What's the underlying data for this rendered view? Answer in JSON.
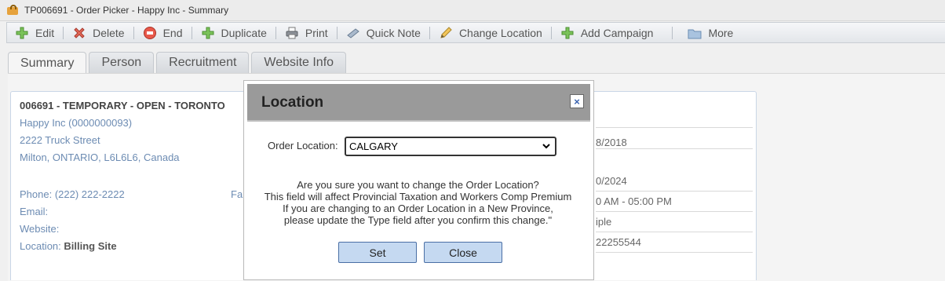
{
  "window": {
    "title": "TP006691 - Order Picker - Happy Inc - Summary",
    "icon": "briefcase-icon"
  },
  "toolbar": {
    "items": [
      {
        "label": "Edit",
        "icon": "plus-icon"
      },
      {
        "label": "Delete",
        "icon": "delete-icon"
      },
      {
        "label": "End",
        "icon": "end-icon"
      },
      {
        "label": "Duplicate",
        "icon": "plus-icon"
      },
      {
        "label": "Print",
        "icon": "printer-icon"
      },
      {
        "label": "Quick Note",
        "icon": "note-icon"
      },
      {
        "label": "Change Location",
        "icon": "pencil-icon"
      },
      {
        "label": "Add Campaign",
        "icon": "plus-icon"
      },
      {
        "label": "More",
        "icon": "folder-icon"
      }
    ]
  },
  "tabs": [
    "Summary",
    "Person",
    "Recruitment",
    "Website Info"
  ],
  "summary": {
    "order_line": "006691 - TEMPORARY - OPEN - TORONTO",
    "company": "Happy Inc (0000000093)",
    "address1": "2222 Truck Street",
    "address2": "Milton, ONTARIO, L6L6L6, Canada",
    "phone_label": "Phone:",
    "phone_value": "(222) 222-2222",
    "fax_label_partial": "Fa",
    "email_label": "Email:",
    "website_label": "Website:",
    "location_label": "Location:",
    "location_value": "Billing Site",
    "right_values": [
      "8/2018",
      "0/2024",
      "0 AM - 05:00 PM",
      "iple",
      "22255544"
    ]
  },
  "dialog": {
    "title": "Location",
    "close_glyph": "×",
    "field_label": "Order Location:",
    "selected_location": "CALGARY",
    "message_lines": [
      "Are you sure you want to change the Order Location?",
      "This field will affect Provincial Taxation and Workers Comp Premium",
      "If you are changing to an Order Location in a New Province,",
      "please update the Type field after you confirm this change.\""
    ],
    "set_label": "Set",
    "close_label": "Close"
  },
  "colors": {
    "accent_blue": "#6d8cb3",
    "dialog_header": "#9a9a9a",
    "button_bg": "#c5d9f1"
  }
}
